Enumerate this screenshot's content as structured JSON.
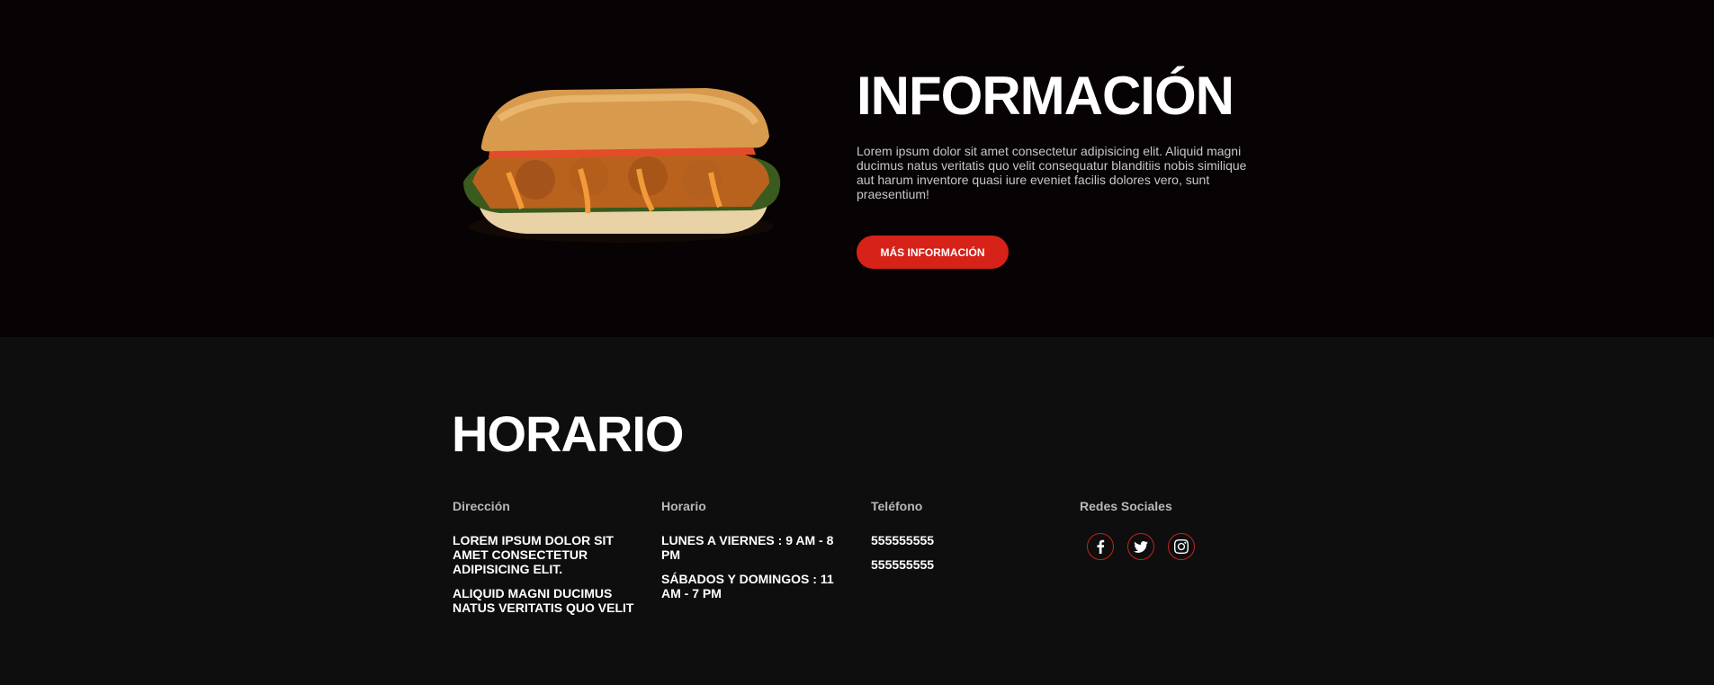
{
  "info": {
    "title": "INFORMACIÓN",
    "text": "Lorem ipsum dolor sit amet consectetur adipisicing elit. Aliquid magni ducimus natus veritatis quo velit consequatur blanditiis nobis similique aut harum inventore quasi iure eveniet facilis dolores vero, sunt praesentium!",
    "button_label": "MÁS INFORMACIÓN",
    "image_icon": "sandwich-image"
  },
  "hours": {
    "title": "HORARIO",
    "address": {
      "heading": "Dirección",
      "lines": [
        "LOREM IPSUM DOLOR SIT AMET CONSECTETUR ADIPISICING ELIT.",
        "ALIQUID MAGNI DUCIMUS NATUS VERITATIS QUO VELIT"
      ]
    },
    "schedule": {
      "heading": "Horario",
      "lines": [
        "LUNES A VIERNES : 9 AM - 8 PM",
        "SÁBADOS Y DOMINGOS : 11 AM - 7 PM"
      ]
    },
    "phone": {
      "heading": "Teléfono",
      "lines": [
        "555555555",
        "555555555"
      ]
    },
    "social": {
      "heading": "Redes Sociales",
      "icons": [
        "facebook-icon",
        "twitter-icon",
        "instagram-icon"
      ]
    }
  },
  "colors": {
    "accent": "#d62218",
    "top_background": "#070203",
    "bottom_background": "#0e0e0e"
  }
}
